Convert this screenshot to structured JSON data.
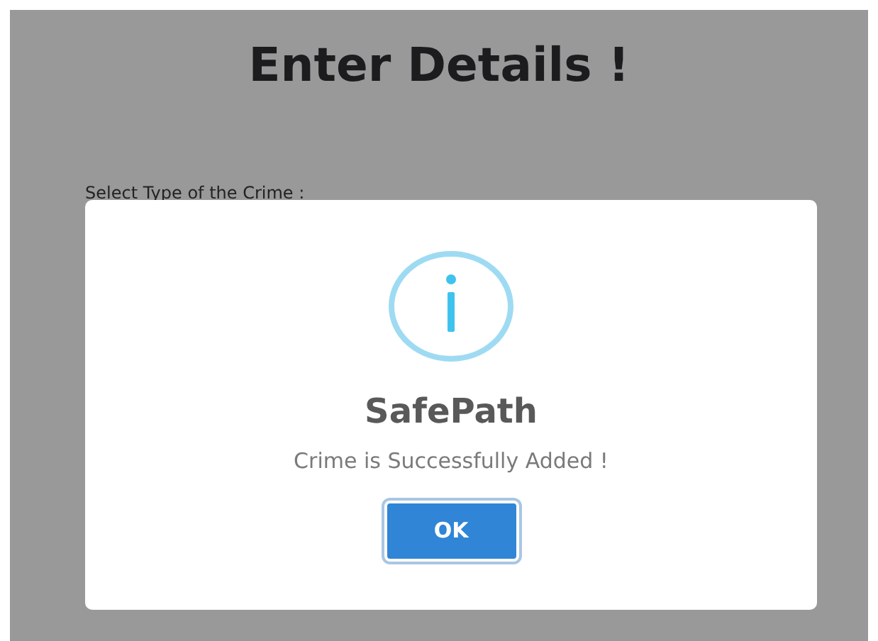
{
  "page": {
    "title": "Enter Details !",
    "field_label": "Select Type of the Crime :"
  },
  "dialog": {
    "title": "SafePath",
    "message": "Crime is Successfully Added !",
    "buttons": [
      "OK"
    ]
  }
}
